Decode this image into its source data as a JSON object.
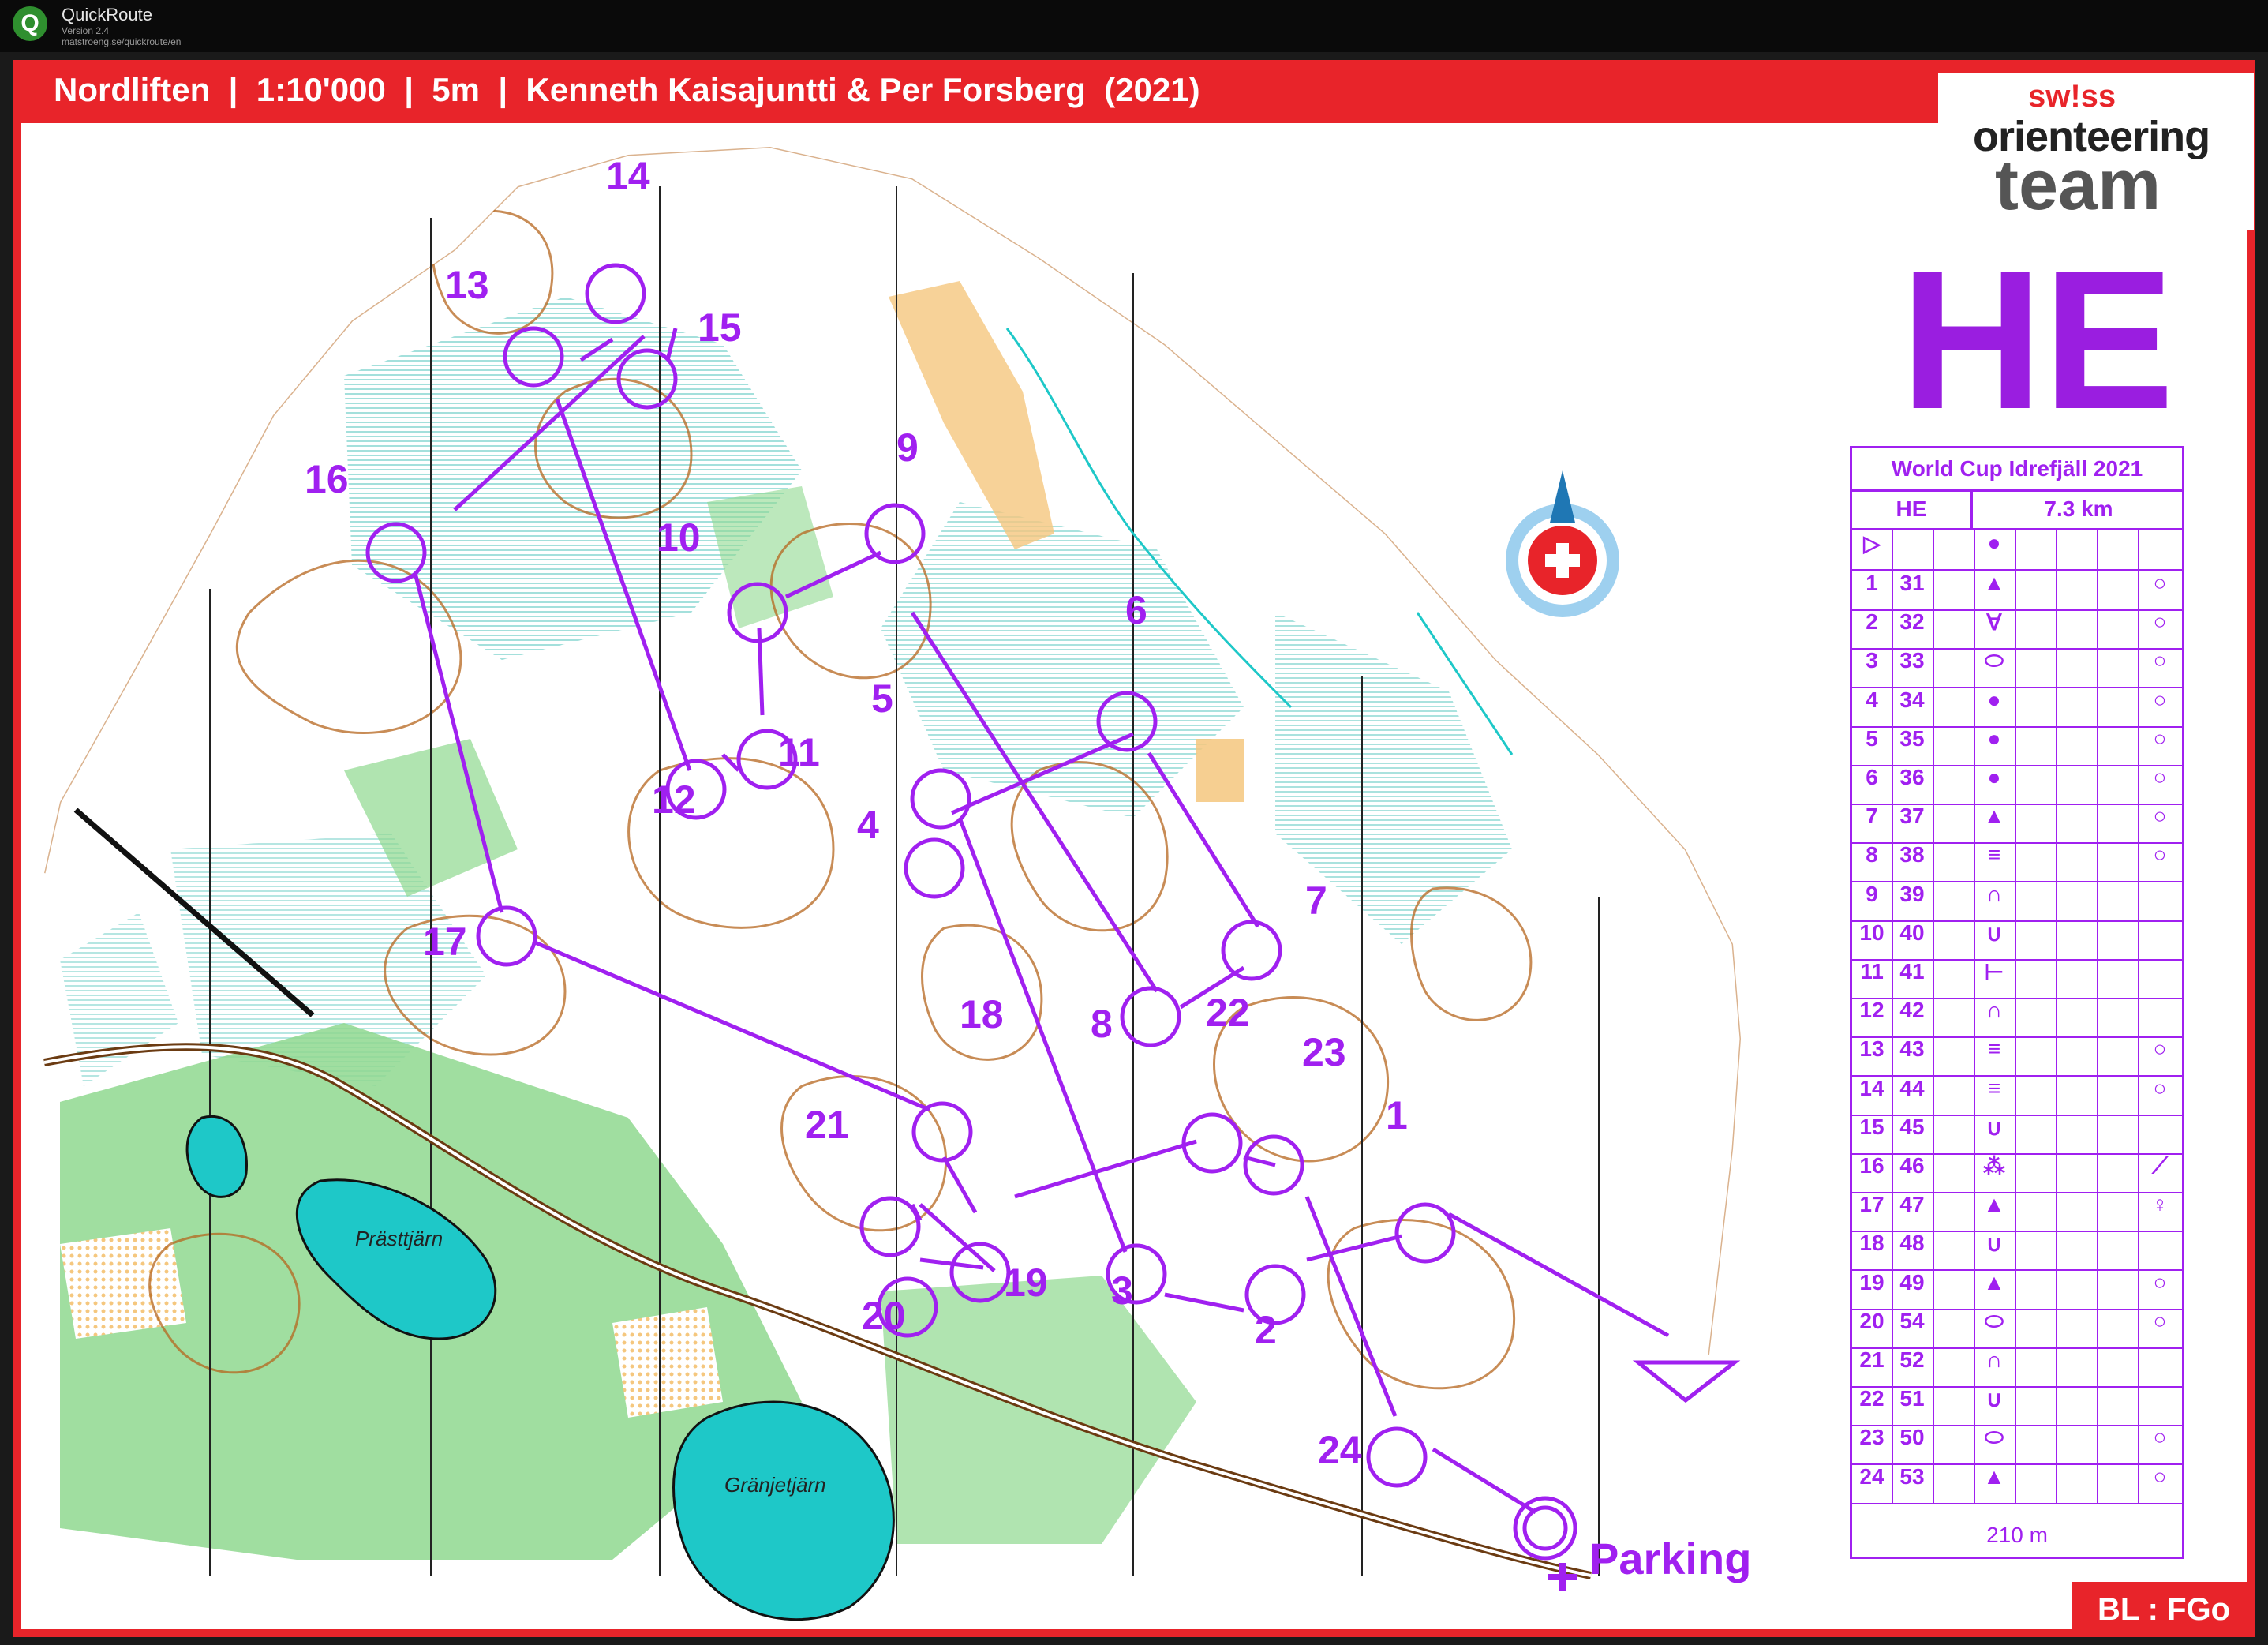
{
  "app": {
    "name": "QuickRoute",
    "version": "Version 2.4",
    "url": "matstroeng.se/quickroute/en",
    "icon_letter": "Q"
  },
  "header": {
    "title": "Nordliften  |  1:10'000  |  5m  |  Kenneth Kaisajuntti & Per Forsberg  (2021)"
  },
  "logo": {
    "swiss": "sw!ss",
    "orienteering": "orienteering",
    "team": "team"
  },
  "class_code": "HE",
  "description_sheet": {
    "event": "World Cup Idrefjäll 2021",
    "class": "HE",
    "length": "7.3 km",
    "rows": [
      {
        "n": "1",
        "code": "31",
        "sym": "▲",
        "extra": "○"
      },
      {
        "n": "2",
        "code": "32",
        "sym": "∀",
        "extra": "○"
      },
      {
        "n": "3",
        "code": "33",
        "sym": "⬭",
        "extra": "○"
      },
      {
        "n": "4",
        "code": "34",
        "sym": "●",
        "extra": "○"
      },
      {
        "n": "5",
        "code": "35",
        "sym": "●",
        "extra": "○"
      },
      {
        "n": "6",
        "code": "36",
        "sym": "●",
        "extra": "○"
      },
      {
        "n": "7",
        "code": "37",
        "sym": "▲",
        "extra": "○"
      },
      {
        "n": "8",
        "code": "38",
        "sym": "≡",
        "extra": "○"
      },
      {
        "n": "9",
        "code": "39",
        "sym": "∩",
        "extra": ""
      },
      {
        "n": "10",
        "code": "40",
        "sym": "∪",
        "extra": ""
      },
      {
        "n": "11",
        "code": "41",
        "sym": "⊢",
        "extra": ""
      },
      {
        "n": "12",
        "code": "42",
        "sym": "∩",
        "extra": ""
      },
      {
        "n": "13",
        "code": "43",
        "sym": "≡",
        "extra": "○"
      },
      {
        "n": "14",
        "code": "44",
        "sym": "≡",
        "extra": "○"
      },
      {
        "n": "15",
        "code": "45",
        "sym": "∪",
        "extra": ""
      },
      {
        "n": "16",
        "code": "46",
        "sym": "⁂",
        "extra": "⟋"
      },
      {
        "n": "17",
        "code": "47",
        "sym": "▲",
        "extra": "♀"
      },
      {
        "n": "18",
        "code": "48",
        "sym": "∪",
        "extra": ""
      },
      {
        "n": "19",
        "code": "49",
        "sym": "▲",
        "extra": "○"
      },
      {
        "n": "20",
        "code": "54",
        "sym": "⬭",
        "extra": "○"
      },
      {
        "n": "21",
        "code": "52",
        "sym": "∩",
        "extra": ""
      },
      {
        "n": "22",
        "code": "51",
        "sym": "∪",
        "extra": ""
      },
      {
        "n": "23",
        "code": "50",
        "sym": "⬭",
        "extra": "○"
      },
      {
        "n": "24",
        "code": "53",
        "sym": "▲",
        "extra": "○"
      }
    ],
    "start_sym": "▷",
    "start_extra": "●",
    "finish_text": "210 m"
  },
  "controls": [
    {
      "n": "1",
      "label": "1"
    },
    {
      "n": "2",
      "label": "2"
    },
    {
      "n": "3",
      "label": "3"
    },
    {
      "n": "4",
      "label": "4"
    },
    {
      "n": "5",
      "label": "5"
    },
    {
      "n": "6",
      "label": "6"
    },
    {
      "n": "7",
      "label": "7"
    },
    {
      "n": "8",
      "label": "8"
    },
    {
      "n": "9",
      "label": "9"
    },
    {
      "n": "10",
      "label": "10"
    },
    {
      "n": "11",
      "label": "11"
    },
    {
      "n": "12",
      "label": "12"
    },
    {
      "n": "13",
      "label": "13"
    },
    {
      "n": "14",
      "label": "14"
    },
    {
      "n": "15",
      "label": "15"
    },
    {
      "n": "16",
      "label": "16"
    },
    {
      "n": "17",
      "label": "17"
    },
    {
      "n": "18",
      "label": "18"
    },
    {
      "n": "19",
      "label": "19"
    },
    {
      "n": "20",
      "label": "20"
    },
    {
      "n": "21",
      "label": "21"
    },
    {
      "n": "22",
      "label": "22"
    },
    {
      "n": "23",
      "label": "23"
    },
    {
      "n": "24",
      "label": "24"
    }
  ],
  "lakes": {
    "lake1": "Prästtjärn",
    "lake2": "Gränjetjärn"
  },
  "parking_label": "Parking",
  "footer_tab": "BL : FGo",
  "colors": {
    "frame_red": "#e8242a",
    "course_purple": "#a020f0",
    "lake_cyan": "#1ec8c8",
    "vegetation_green": "#8fd88f",
    "open_yellow": "#f5c77e",
    "contour_brown": "#b5651d"
  }
}
